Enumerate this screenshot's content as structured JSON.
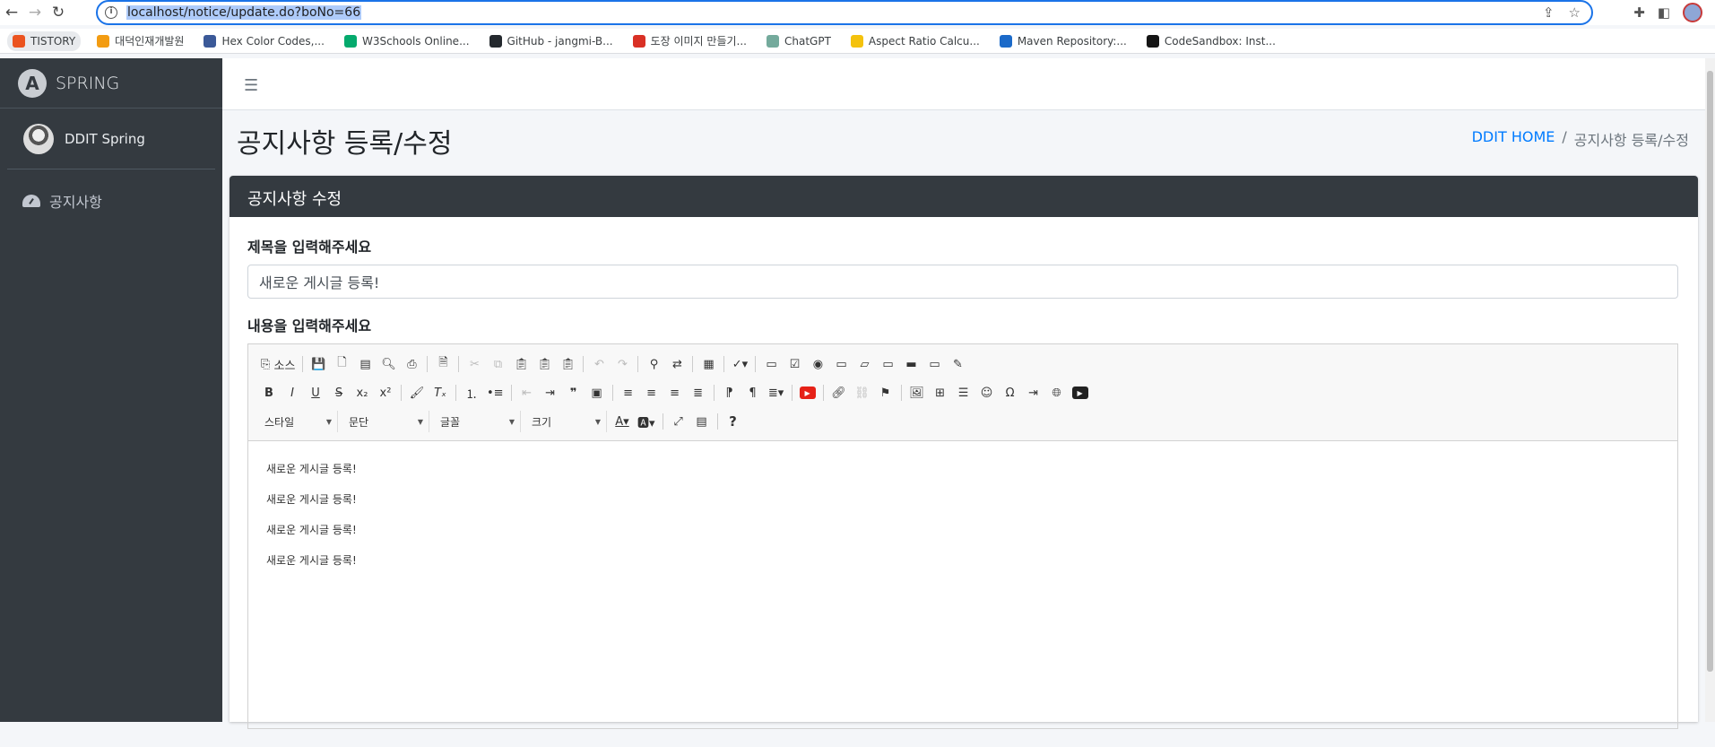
{
  "browser": {
    "url": "localhost/notice/update.do?boNo=66",
    "bookmarks": [
      {
        "label": "TISTORY",
        "color": "#eb531f"
      },
      {
        "label": "대덕인재개발원",
        "color": "#f39c12"
      },
      {
        "label": "Hex Color Codes,...",
        "color": "#3b5998"
      },
      {
        "label": "W3Schools Online...",
        "color": "#04aa6d"
      },
      {
        "label": "GitHub - jangmi-B...",
        "color": "#24292e"
      },
      {
        "label": "도장 이미지 만들기...",
        "color": "#d93025"
      },
      {
        "label": "ChatGPT",
        "color": "#74aa9c"
      },
      {
        "label": "Aspect Ratio Calcu...",
        "color": "#f4c20d"
      },
      {
        "label": "Maven Repository:...",
        "color": "#1b6ac9"
      },
      {
        "label": "CodeSandbox: Inst...",
        "color": "#151515"
      }
    ]
  },
  "sidebar": {
    "brand": "SPRING",
    "user_name": "DDIT Spring",
    "menu": [
      {
        "label": "공지사항",
        "icon": "tachometer-icon"
      }
    ]
  },
  "header": {
    "page_title": "공지사항 등록/수정",
    "breadcrumb_home": "DDIT HOME",
    "breadcrumb_sep": "/",
    "breadcrumb_current": "공지사항 등록/수정"
  },
  "card": {
    "title": "공지사항 수정",
    "title_label": "제목을 입력해주세요",
    "title_value": "새로운 게시글 등록!",
    "content_label": "내용을 입력해주세요"
  },
  "editor": {
    "source_label": "소스",
    "combos": [
      "스타일",
      "문단",
      "글꼴",
      "크기"
    ],
    "body_lines": [
      "새로운 게시글 등록!",
      "새로운 게시글 등록!",
      "새로운 게시글 등록!",
      "새로운 게시글 등록!"
    ]
  },
  "colors": {
    "sidebar_bg": "#343a40",
    "accent_link": "#007bff",
    "card_header_bg": "#343a40"
  }
}
